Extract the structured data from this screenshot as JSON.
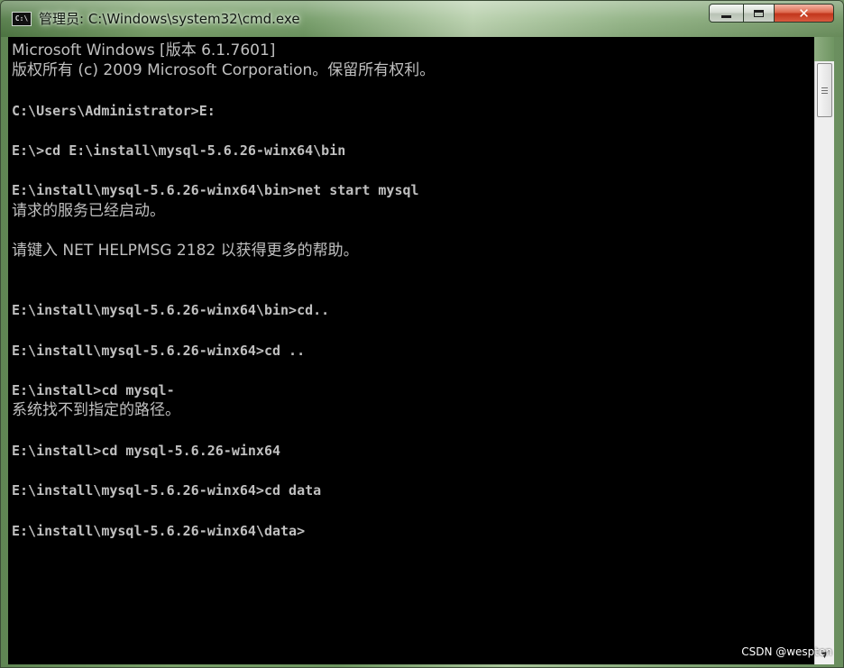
{
  "window": {
    "title": "管理员: C:\\Windows\\system32\\cmd.exe",
    "icon_text": "C:\\",
    "icons": {
      "app": "cmd-icon",
      "minimize": "minimize-icon",
      "maximize": "maximize-icon",
      "close": "close-icon"
    },
    "close_glyph": "✕"
  },
  "console": {
    "lines": [
      "Microsoft Windows [版本 6.1.7601]",
      "版权所有 (c) 2009 Microsoft Corporation。保留所有权利。",
      "",
      "C:\\Users\\Administrator>E:",
      "",
      "E:\\>cd E:\\install\\mysql-5.6.26-winx64\\bin",
      "",
      "E:\\install\\mysql-5.6.26-winx64\\bin>net start mysql",
      "请求的服务已经启动。",
      "",
      "请键入 NET HELPMSG 2182 以获得更多的帮助。",
      "",
      "",
      "E:\\install\\mysql-5.6.26-winx64\\bin>cd..",
      "",
      "E:\\install\\mysql-5.6.26-winx64>cd ..",
      "",
      "E:\\install>cd mysql-",
      "系统找不到指定的路径。",
      "",
      "E:\\install>cd mysql-5.6.26-winx64",
      "",
      "E:\\install\\mysql-5.6.26-winx64>cd data",
      "",
      "E:\\install\\mysql-5.6.26-winx64\\data>"
    ]
  },
  "scrollbar": {
    "up_glyph": "▲",
    "down_glyph": "▼"
  },
  "watermark": "CSDN @wespten",
  "colors": {
    "console_bg": "#000000",
    "console_text": "#c0c0c0",
    "close_button": "#c2361c"
  }
}
